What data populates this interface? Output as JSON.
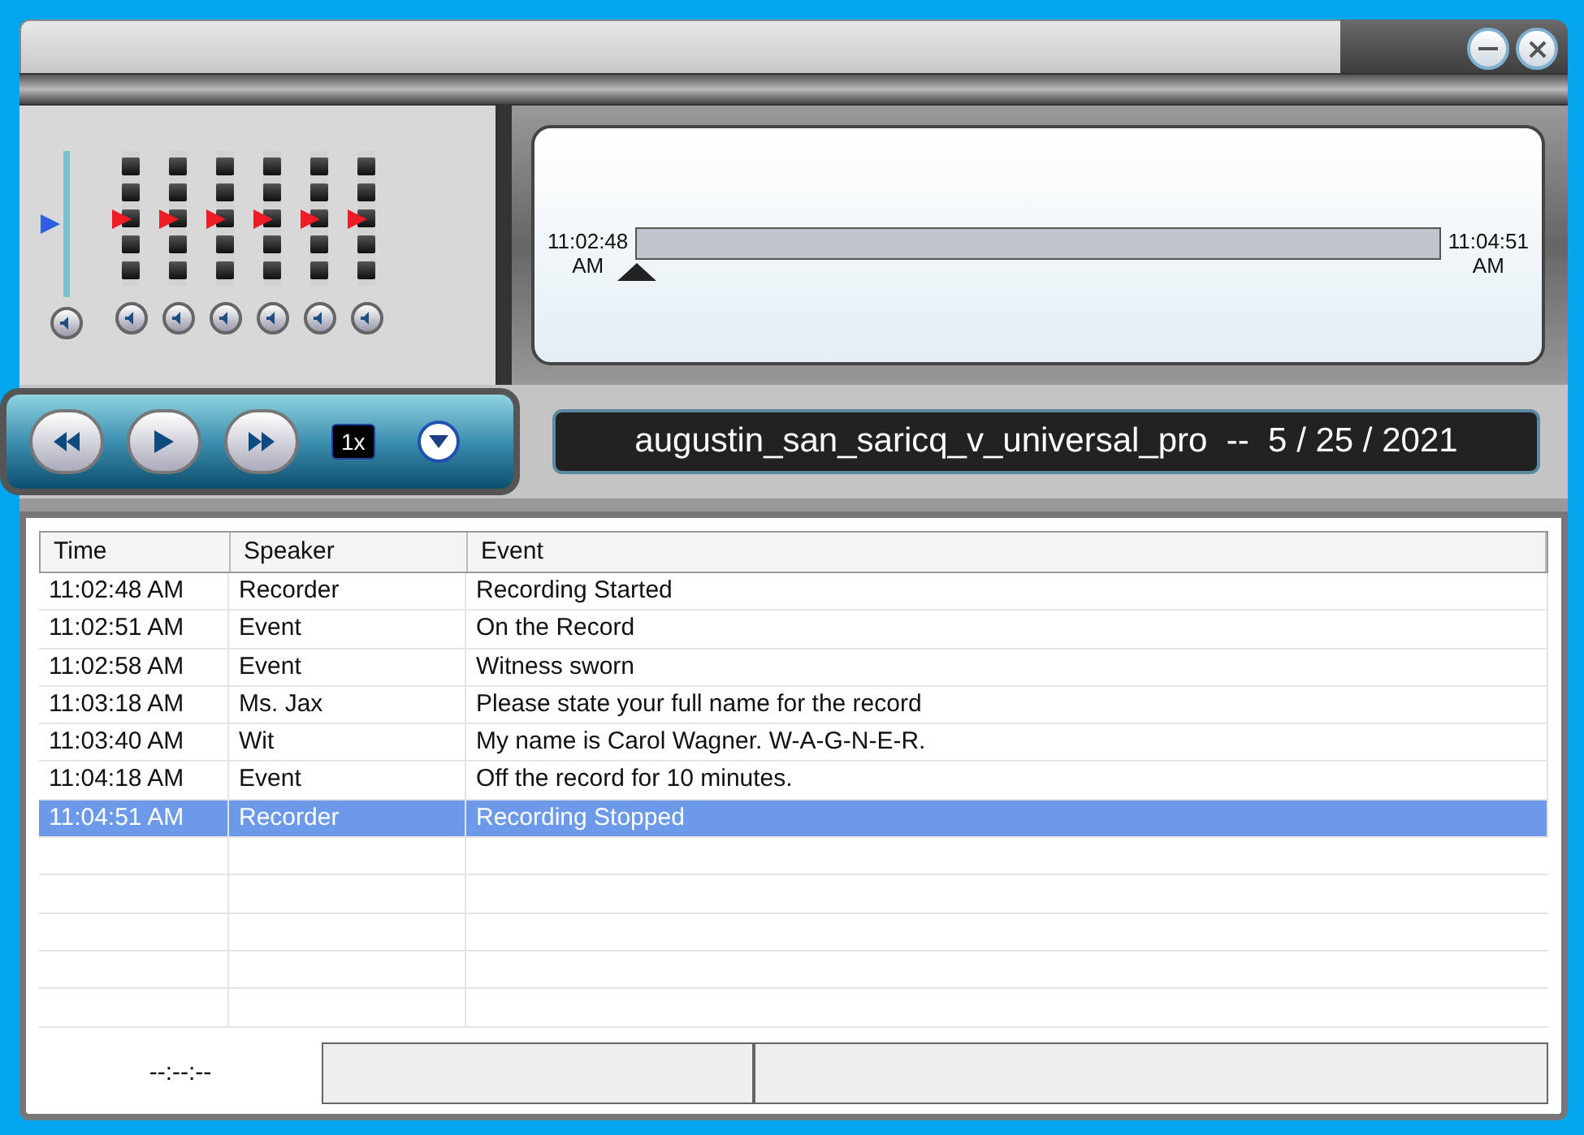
{
  "mixer": {
    "master": {
      "level": 0.5
    },
    "channels": [
      {
        "level": 0.5
      },
      {
        "level": 0.5
      },
      {
        "level": 0.5
      },
      {
        "level": 0.5
      },
      {
        "level": 0.5
      },
      {
        "level": 0.5
      }
    ]
  },
  "timeline": {
    "start": "11:02:48\nAM",
    "end": "11:04:51\nAM",
    "level": 0
  },
  "transport": {
    "speed": "1x"
  },
  "session_title": "augustin_san_saricq_v_universal_pro  --  5 / 25 / 2021",
  "table": {
    "columns": [
      "Time",
      "Speaker",
      "Event"
    ],
    "rows": [
      {
        "cells": [
          "11:02:48 AM",
          "Recorder",
          "Recording Started"
        ],
        "selected": false
      },
      {
        "cells": [
          "11:02:51 AM",
          "Event",
          "On the Record"
        ],
        "selected": false
      },
      {
        "cells": [
          "11:02:58 AM",
          "Event",
          "Witness sworn"
        ],
        "selected": false
      },
      {
        "cells": [
          "11:03:18 AM",
          "Ms. Jax",
          "Please state your full name for the record"
        ],
        "selected": false
      },
      {
        "cells": [
          "11:03:40 AM",
          "Wit",
          "My name is Carol Wagner. W-A-G-N-E-R."
        ],
        "selected": false
      },
      {
        "cells": [
          "11:04:18 AM",
          "Event",
          "Off the record for 10 minutes."
        ],
        "selected": false
      },
      {
        "cells": [
          "11:04:51 AM",
          "Recorder",
          "Recording Stopped"
        ],
        "selected": true
      }
    ]
  },
  "footer": {
    "clock": "--:--:--"
  }
}
